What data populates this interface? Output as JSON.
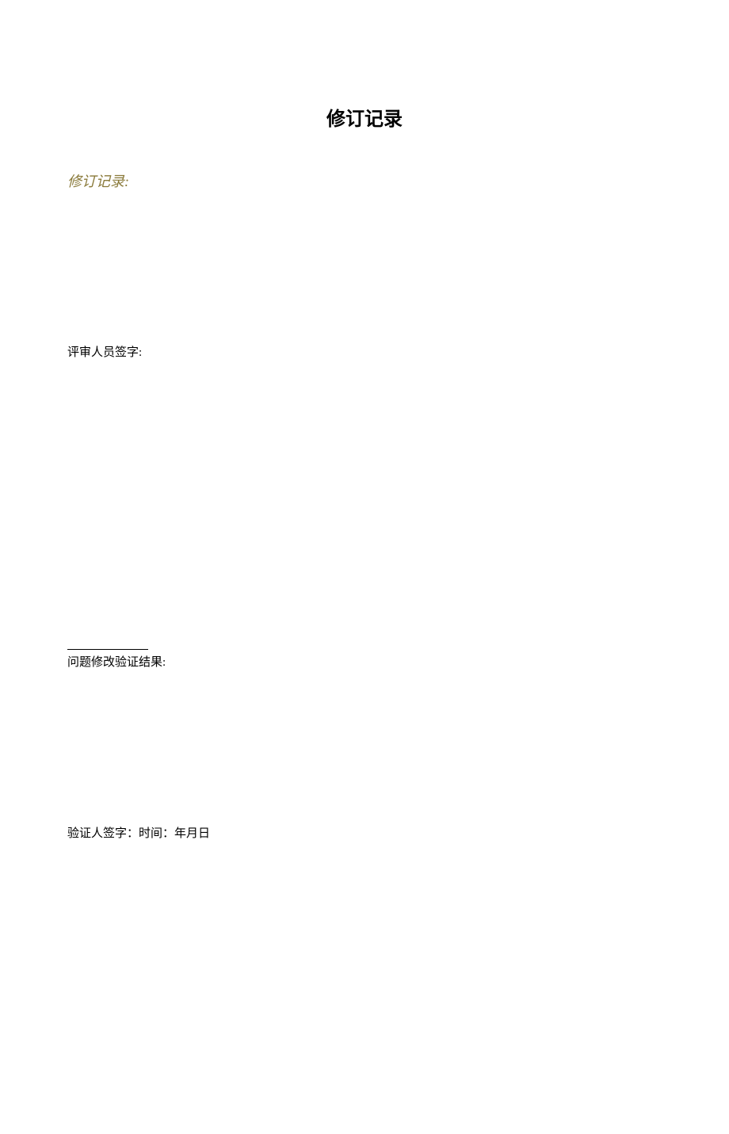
{
  "title": "修订记录",
  "revisionRecordLabel": "修订记录:",
  "reviewerSignatureLabel": "评审人员签字:",
  "verificationResultLabel": "问题修改验证结果:",
  "verifierSignatureLabel": "验证人签字：时间：年月日"
}
